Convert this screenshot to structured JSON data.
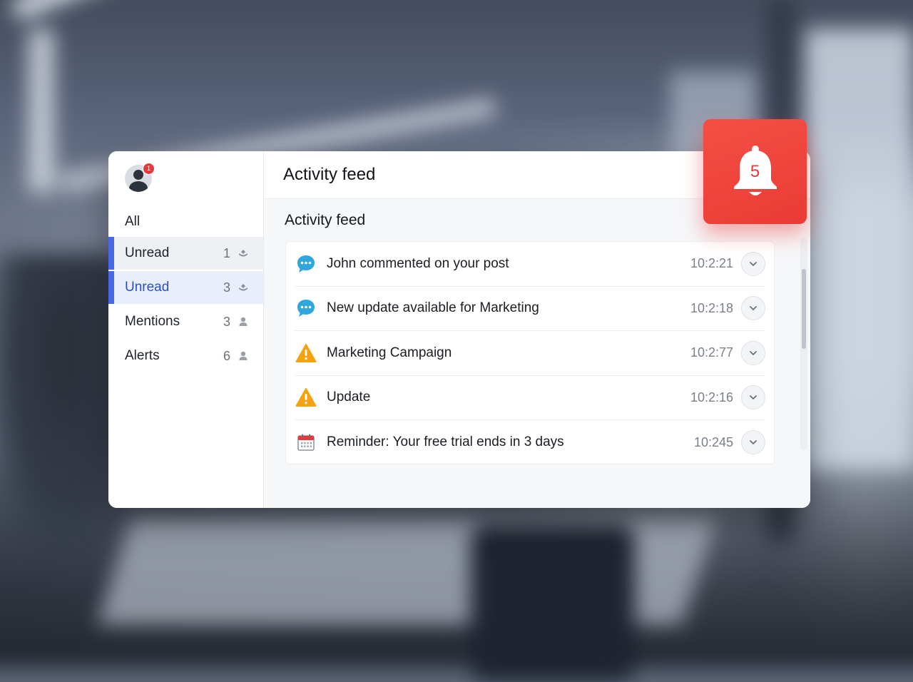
{
  "window": {
    "title": "Activity feed"
  },
  "user": {
    "avatar_icon": "user-avatar-icon",
    "badge_count": "1"
  },
  "sidebar": {
    "items": [
      {
        "label": "All",
        "count": "",
        "icon": ""
      },
      {
        "label": "Unread",
        "count": "1",
        "icon": "stack-icon"
      },
      {
        "label": "Unread",
        "count": "3",
        "icon": "stack-icon"
      },
      {
        "label": "Mentions",
        "count": "3",
        "icon": "person-icon"
      },
      {
        "label": "Alerts",
        "count": "6",
        "icon": "person-icon"
      }
    ]
  },
  "main": {
    "section_title": "Activity feed",
    "feed": [
      {
        "icon": "chat-bubble-icon",
        "text": "John commented on your post",
        "time": "10:2:21"
      },
      {
        "icon": "chat-bubble-icon",
        "text": "New update available for Marketing",
        "time": "10:2:18"
      },
      {
        "icon": "warning-icon",
        "text": "Marketing Campaign",
        "time": "10:2:77"
      },
      {
        "icon": "warning-icon",
        "text": "Update",
        "time": "10:2:16"
      },
      {
        "icon": "calendar-icon",
        "text": "Reminder: Your free trial ends in 3 days",
        "time": "10:245"
      }
    ]
  },
  "notification": {
    "icon": "bell-icon",
    "count": "5"
  },
  "colors": {
    "accent": "#4a67e6",
    "bell_tile": "#ef4640",
    "badge": "#e8383d",
    "chat_icon": "#2fa7dc",
    "warning_icon": "#f6a20f"
  }
}
